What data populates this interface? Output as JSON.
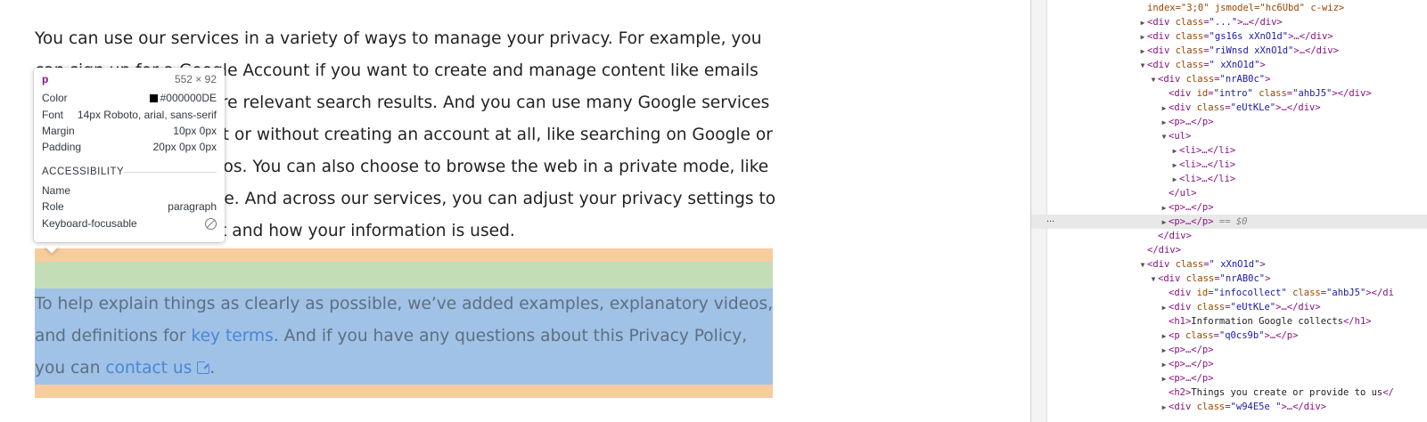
{
  "page": {
    "paragraph1": [
      "You can use our services in a variety of ways to manage your privacy. For example, you",
      "can sign up for a Google Account if you want to create and manage content like emails",
      "and photos, or see more relevant search results. And you can use many Google services",
      "when you're signed out or without creating an account at all, like searching on Google or",
      "watching YouTube videos. You can also choose to browse the web in a private mode, like",
      "Chrome Incognito mode. And across our services, you can adjust your privacy settings to",
      "control what we collect and how your information is used."
    ],
    "paragraph2": {
      "line1": "To help explain things as clearly as possible, we’ve added examples, explanatory videos,",
      "line2_before": "and definitions for ",
      "line2_link": "key terms",
      "line2_after": ". And if you have any questions about this Privacy Policy,",
      "line3_before": "you can ",
      "line3_link": "contact us",
      "line3_after": "."
    }
  },
  "tooltip": {
    "tag": "p",
    "size": "552 × 92",
    "color_label": "Color",
    "color_value": "#000000DE",
    "font_label": "Font",
    "font_value": "14px Roboto, arial, sans-serif",
    "margin_label": "Margin",
    "margin_value": "10px 0px",
    "padding_label": "Padding",
    "padding_value": "20px 0px 0px",
    "section_title": "ACCESSIBILITY",
    "name_label": "Name",
    "role_label": "Role",
    "role_value": "paragraph",
    "focus_label": "Keyboard-focusable",
    "focus_icon": "not-focusable-icon"
  },
  "devtools": {
    "ellipsis": "...",
    "lines": [
      {
        "indent": 0,
        "tri": "",
        "html": [
          [
            "an",
            "index=\"3;0\" jsmodel=\"hc6Ubd\" c-wiz>"
          ]
        ]
      },
      {
        "indent": 0,
        "tri": "▶",
        "html": [
          [
            "tn",
            "<div "
          ],
          [
            "an",
            "class"
          ],
          [
            "tn",
            "="
          ],
          [
            "av",
            "\"...\""
          ],
          [
            "tn",
            ">…</div>"
          ]
        ]
      },
      {
        "indent": 0,
        "tri": "▶",
        "html": [
          [
            "tn",
            "<div "
          ],
          [
            "an",
            "class"
          ],
          [
            "tn",
            "="
          ],
          [
            "av",
            "\"gs16s xXnO1d\""
          ],
          [
            "tn",
            ">…</div>"
          ]
        ]
      },
      {
        "indent": 0,
        "tri": "▶",
        "html": [
          [
            "tn",
            "<div "
          ],
          [
            "an",
            "class"
          ],
          [
            "tn",
            "="
          ],
          [
            "av",
            "\"riWnsd xXnO1d\""
          ],
          [
            "tn",
            ">…</div>"
          ]
        ]
      },
      {
        "indent": 0,
        "tri": "▼",
        "html": [
          [
            "tn",
            "<div "
          ],
          [
            "an",
            "class"
          ],
          [
            "tn",
            "="
          ],
          [
            "av",
            "\" xXnO1d\""
          ],
          [
            "tn",
            ">"
          ]
        ]
      },
      {
        "indent": 1,
        "tri": "▼",
        "html": [
          [
            "tn",
            "<div "
          ],
          [
            "an",
            "class"
          ],
          [
            "tn",
            "="
          ],
          [
            "av",
            "\"nrAB0c\""
          ],
          [
            "tn",
            ">"
          ]
        ]
      },
      {
        "indent": 2,
        "tri": "",
        "html": [
          [
            "tn",
            "<div "
          ],
          [
            "an",
            "id"
          ],
          [
            "tn",
            "="
          ],
          [
            "av",
            "\"intro\""
          ],
          [
            "tn",
            " "
          ],
          [
            "an",
            "class"
          ],
          [
            "tn",
            "="
          ],
          [
            "av",
            "\"ahbJ5\""
          ],
          [
            "tn",
            "></div>"
          ]
        ]
      },
      {
        "indent": 2,
        "tri": "▶",
        "html": [
          [
            "tn",
            "<div "
          ],
          [
            "an",
            "class"
          ],
          [
            "tn",
            "="
          ],
          [
            "av",
            "\"eUtKLe\""
          ],
          [
            "tn",
            ">…</div>"
          ]
        ]
      },
      {
        "indent": 2,
        "tri": "▶",
        "html": [
          [
            "tn",
            "<p>…</p>"
          ]
        ]
      },
      {
        "indent": 2,
        "tri": "▼",
        "html": [
          [
            "tn",
            "<ul>"
          ]
        ]
      },
      {
        "indent": 3,
        "tri": "▶",
        "html": [
          [
            "tn",
            "<li>…</li>"
          ]
        ]
      },
      {
        "indent": 3,
        "tri": "▶",
        "html": [
          [
            "tn",
            "<li>…</li>"
          ]
        ]
      },
      {
        "indent": 3,
        "tri": "▶",
        "html": [
          [
            "tn",
            "<li>…</li>"
          ]
        ]
      },
      {
        "indent": 2,
        "tri": "",
        "html": [
          [
            "tn",
            "</ul>"
          ]
        ]
      },
      {
        "indent": 2,
        "tri": "▶",
        "html": [
          [
            "tn",
            "<p>…</p>"
          ]
        ]
      },
      {
        "indent": 2,
        "tri": "▶",
        "html": [
          [
            "tn",
            "<p>…</p>"
          ],
          [
            "eq",
            " == $0"
          ]
        ],
        "selected": true
      },
      {
        "indent": 1,
        "tri": "",
        "html": [
          [
            "tn",
            "</div>"
          ]
        ]
      },
      {
        "indent": 0,
        "tri": "",
        "html": [
          [
            "tn",
            "</div>"
          ]
        ]
      },
      {
        "indent": 0,
        "tri": "▼",
        "html": [
          [
            "tn",
            "<div "
          ],
          [
            "an",
            "class"
          ],
          [
            "tn",
            "="
          ],
          [
            "av",
            "\" xXnO1d\""
          ],
          [
            "tn",
            ">"
          ]
        ]
      },
      {
        "indent": 1,
        "tri": "▼",
        "html": [
          [
            "tn",
            "<div "
          ],
          [
            "an",
            "class"
          ],
          [
            "tn",
            "="
          ],
          [
            "av",
            "\"nrAB0c\""
          ],
          [
            "tn",
            ">"
          ]
        ]
      },
      {
        "indent": 2,
        "tri": "",
        "html": [
          [
            "tn",
            "<div "
          ],
          [
            "an",
            "id"
          ],
          [
            "tn",
            "="
          ],
          [
            "av",
            "\"infocollect\""
          ],
          [
            "tn",
            " "
          ],
          [
            "an",
            "class"
          ],
          [
            "tn",
            "="
          ],
          [
            "av",
            "\"ahbJ5\""
          ],
          [
            "tn",
            "></di"
          ]
        ]
      },
      {
        "indent": 2,
        "tri": "▶",
        "html": [
          [
            "tn",
            "<div "
          ],
          [
            "an",
            "class"
          ],
          [
            "tn",
            "="
          ],
          [
            "av",
            "\"eUtKLe\""
          ],
          [
            "tn",
            ">…</div>"
          ]
        ]
      },
      {
        "indent": 2,
        "tri": "",
        "html": [
          [
            "tn",
            "<h1>"
          ],
          [
            "tx",
            "Information Google collects"
          ],
          [
            "tn",
            "</h1>"
          ]
        ]
      },
      {
        "indent": 2,
        "tri": "▶",
        "html": [
          [
            "tn",
            "<p "
          ],
          [
            "an",
            "class"
          ],
          [
            "tn",
            "="
          ],
          [
            "av",
            "\"q0cs9b\""
          ],
          [
            "tn",
            ">…</p>"
          ]
        ]
      },
      {
        "indent": 2,
        "tri": "▶",
        "html": [
          [
            "tn",
            "<p>…</p>"
          ]
        ]
      },
      {
        "indent": 2,
        "tri": "▶",
        "html": [
          [
            "tn",
            "<p>…</p>"
          ]
        ]
      },
      {
        "indent": 2,
        "tri": "▶",
        "html": [
          [
            "tn",
            "<p>…</p>"
          ]
        ]
      },
      {
        "indent": 2,
        "tri": "",
        "html": [
          [
            "tn",
            "<h2>"
          ],
          [
            "tx",
            "Things you create or provide to us"
          ],
          [
            "tn",
            "</"
          ]
        ]
      },
      {
        "indent": 2,
        "tri": "▶",
        "html": [
          [
            "tn",
            "<div "
          ],
          [
            "an",
            "class"
          ],
          [
            "tn",
            "="
          ],
          [
            "av",
            "\"w94E5e \""
          ],
          [
            "tn",
            ">…</div>"
          ]
        ]
      }
    ]
  }
}
